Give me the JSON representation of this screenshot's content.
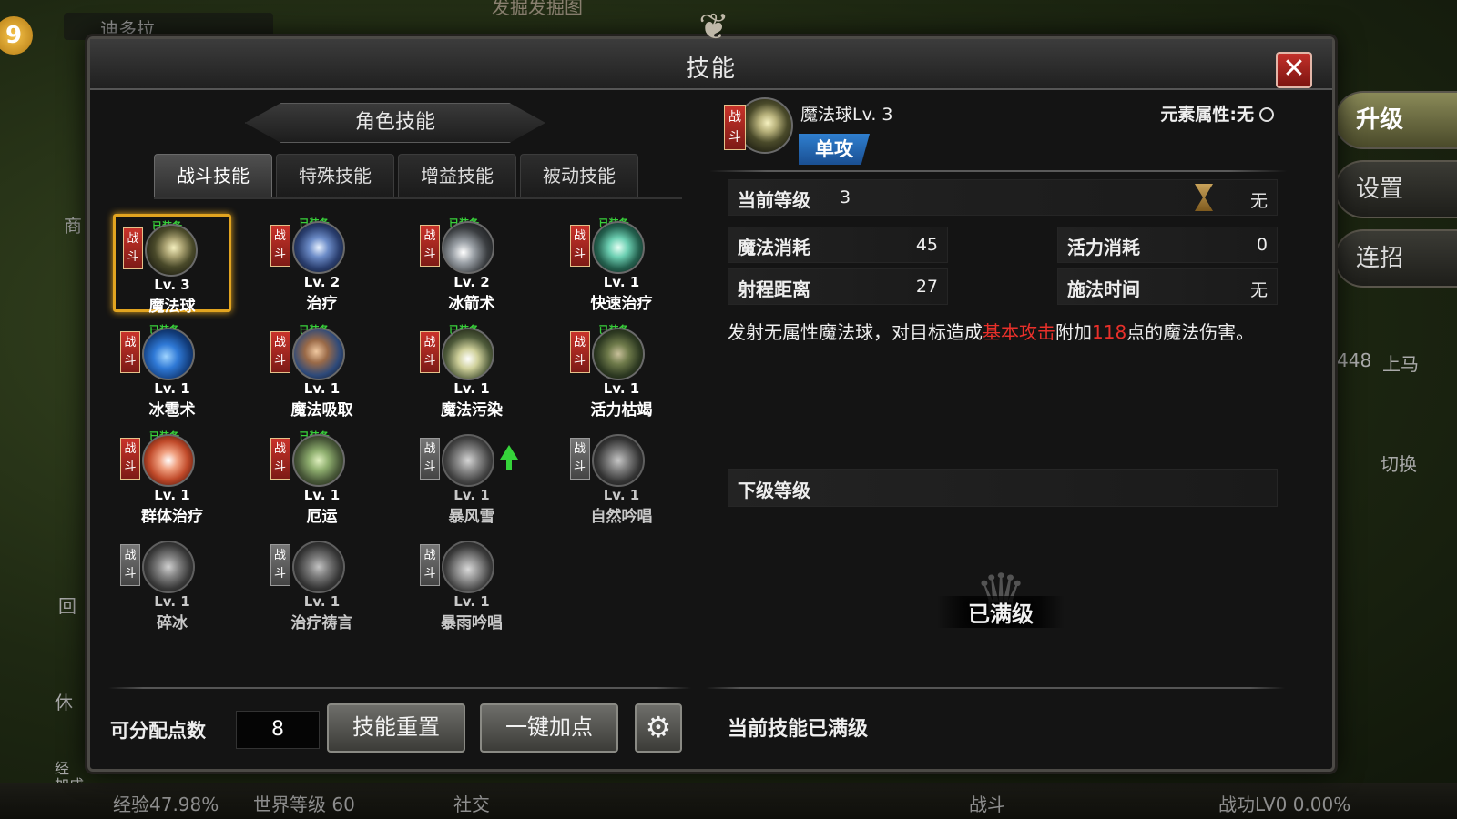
{
  "hud": {
    "player_name": "迪多拉",
    "top_center": "发掘发掘图",
    "level_badge": "9",
    "upgrade_label": "升级",
    "settings_label": "设置",
    "combo_label": "连招",
    "side_shop": "商",
    "side_return": "回",
    "side_rest": "休",
    "side_count": "448",
    "side_mount": "上马",
    "side_switch": "切换",
    "side_exp_boost": "经\n加成",
    "bottom_exp": "经验47.98%",
    "bottom_world_level": "世界等级 60",
    "bottom_social": "社交",
    "bottom_battle": "战斗",
    "bottom_power": "战功LV0 0.00%"
  },
  "dialog": {
    "title": "技能",
    "section_title": "角色技能",
    "tabs": [
      "战斗技能",
      "特殊技能",
      "增益技能",
      "被动技能"
    ],
    "active_tab": 0
  },
  "skills": [
    {
      "name": "魔法球",
      "level": "Lv. 3",
      "category": "战\n斗",
      "equipped_tag": "已装备",
      "icon": "magic-orb-icon",
      "selected": true,
      "locked": false
    },
    {
      "name": "治疗",
      "level": "Lv. 2",
      "category": "战\n斗",
      "equipped_tag": "已装备",
      "icon": "heal-cross-icon",
      "selected": false,
      "locked": false
    },
    {
      "name": "冰箭术",
      "level": "Lv. 2",
      "category": "战\n斗",
      "equipped_tag": "已装备",
      "icon": "ice-arrow-icon",
      "selected": false,
      "locked": false
    },
    {
      "name": "快速治疗",
      "level": "Lv. 1",
      "category": "战\n斗",
      "equipped_tag": "已装备",
      "icon": "quick-heal-icon",
      "selected": false,
      "locked": false
    },
    {
      "name": "冰雹术",
      "level": "Lv. 1",
      "category": "战\n斗",
      "equipped_tag": "已装备",
      "icon": "hail-icon",
      "selected": false,
      "locked": false
    },
    {
      "name": "魔法吸取",
      "level": "Lv. 1",
      "category": "战\n斗",
      "equipped_tag": "已装备",
      "icon": "mana-drain-icon",
      "selected": false,
      "locked": false
    },
    {
      "name": "魔法污染",
      "level": "Lv. 1",
      "category": "战\n斗",
      "equipped_tag": "已装备",
      "icon": "mana-pollution-icon",
      "selected": false,
      "locked": false
    },
    {
      "name": "活力枯竭",
      "level": "Lv. 1",
      "category": "战\n斗",
      "equipped_tag": "已装备",
      "icon": "vitality-drain-icon",
      "selected": false,
      "locked": false
    },
    {
      "name": "群体治疗",
      "level": "Lv. 1",
      "category": "战\n斗",
      "equipped_tag": "已装备",
      "icon": "group-heal-icon",
      "selected": false,
      "locked": false
    },
    {
      "name": "厄运",
      "level": "Lv. 1",
      "category": "战\n斗",
      "equipped_tag": "已装备",
      "icon": "doom-clover-icon",
      "selected": false,
      "locked": false
    },
    {
      "name": "暴风雪",
      "level": "Lv. 1",
      "category": "战\n斗",
      "equipped_tag": "",
      "icon": "blizzard-icon",
      "selected": false,
      "locked": true,
      "upgradable": true
    },
    {
      "name": "自然吟唱",
      "level": "Lv. 1",
      "category": "战\n斗",
      "equipped_tag": "",
      "icon": "nature-chant-icon",
      "selected": false,
      "locked": true
    },
    {
      "name": "碎冰",
      "level": "Lv. 1",
      "category": "战\n斗",
      "equipped_tag": "",
      "icon": "shatter-ice-icon",
      "selected": false,
      "locked": true
    },
    {
      "name": "治疗祷言",
      "level": "Lv. 1",
      "category": "战\n斗",
      "equipped_tag": "",
      "icon": "heal-prayer-icon",
      "selected": false,
      "locked": true
    },
    {
      "name": "暴雨吟唱",
      "level": "Lv. 1",
      "category": "战\n斗",
      "equipped_tag": "",
      "icon": "storm-chant-icon",
      "selected": false,
      "locked": true
    }
  ],
  "detail": {
    "category": "战\n斗",
    "name": "魔法球Lv. 3",
    "element": "元素属性:无",
    "attack_type": "单攻",
    "current_level_label": "当前等级",
    "current_level_value": "3",
    "cast_cd_value": "无",
    "mana_cost_label": "魔法消耗",
    "mana_cost_value": "45",
    "vitality_cost_label": "活力消耗",
    "vitality_cost_value": "0",
    "range_label": "射程距离",
    "range_value": "27",
    "cast_time_label": "施法时间",
    "cast_time_value": "无",
    "desc_part1": "发射无属性魔法球，对目标造成",
    "desc_hl1": "基本攻击",
    "desc_part2": "附加",
    "desc_hl2": "118",
    "desc_part3": "点的魔法伤害。",
    "next_level_label": "下级等级",
    "max_level_text": "已满级"
  },
  "footer": {
    "points_label": "可分配点数",
    "points_value": "8",
    "reset_label": "技能重置",
    "auto_label": "一键加点",
    "status_text": "当前技能已满级"
  },
  "colors": {
    "highlight": "#e8302a",
    "selected_frame": "#e2a420",
    "equipped": "#38d03a",
    "attack_tag": "#2f7fcf"
  }
}
